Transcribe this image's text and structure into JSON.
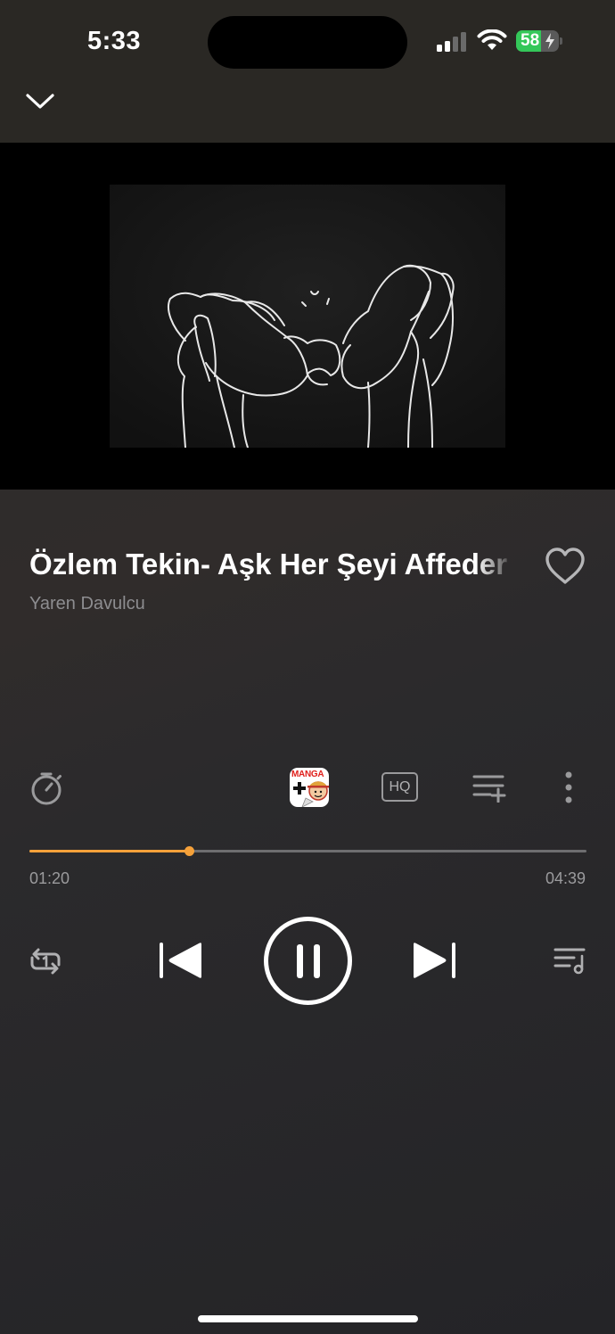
{
  "status_bar": {
    "time": "5:33",
    "battery_percent": "58",
    "battery_level": 0.58,
    "battery_color": "#34c759",
    "signal_icon": "cellular-signal-icon",
    "wifi_icon": "wifi-icon"
  },
  "header": {
    "collapse_icon": "chevron-down-icon"
  },
  "track": {
    "title": "Özlem Tekin- Aşk Her Şeyi Affeder",
    "artist": "Yaren Davulcu",
    "favorite_icon": "heart-outline-icon"
  },
  "toolbar": {
    "timer_icon": "sleep-timer-icon",
    "app_badge_label": "MANGA",
    "quality_label": "HQ",
    "add_to_queue_icon": "add-to-playlist-icon",
    "more_icon": "more-vertical-icon"
  },
  "progress": {
    "elapsed": "01:20",
    "total": "04:39",
    "fraction": 0.287,
    "accent_color": "#f5a13a"
  },
  "controls": {
    "repeat_icon": "repeat-one-icon",
    "previous_icon": "skip-previous-icon",
    "play_state_icon": "pause-icon",
    "next_icon": "skip-next-icon",
    "queue_icon": "music-queue-icon"
  }
}
